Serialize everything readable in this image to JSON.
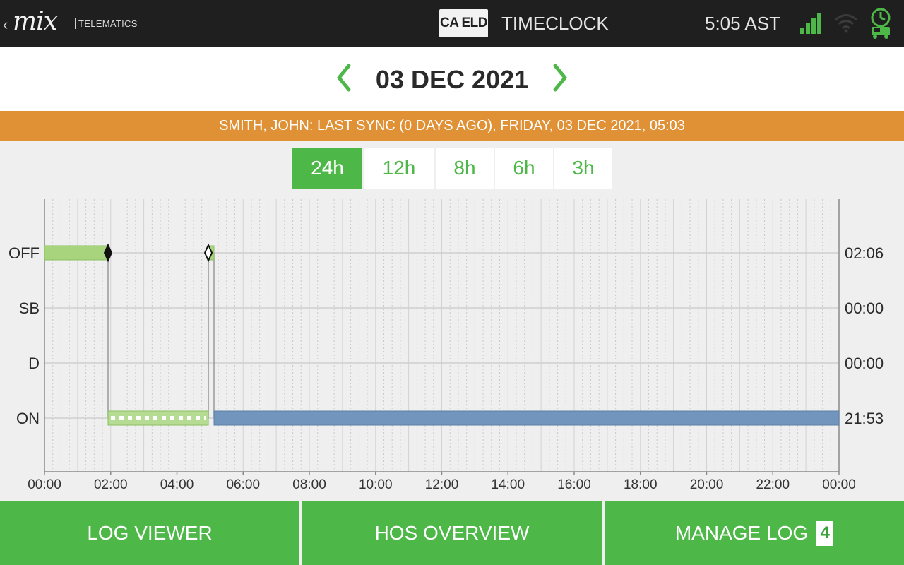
{
  "header": {
    "logo_text": "mix",
    "logo_sub": "TELEMATICS",
    "badge": "CA ELD",
    "title": "TIMECLOCK",
    "time": "5:05 AST",
    "icons": [
      "back-chevron-icon",
      "signal-bars-icon",
      "wifi-icon",
      "truck-clock-icon"
    ],
    "accent_color": "#4db748"
  },
  "date_nav": {
    "date": "03 DEC 2021",
    "prev_icon": "chevron-left-icon",
    "next_icon": "chevron-right-icon"
  },
  "sync_banner": {
    "text": "SMITH, JOHN: LAST SYNC (0 DAYS AGO), FRIDAY, 03 DEC 2021, 05:03",
    "color": "#e09035"
  },
  "range_tabs": [
    {
      "label": "24h",
      "active": true
    },
    {
      "label": "12h",
      "active": false
    },
    {
      "label": "8h",
      "active": false
    },
    {
      "label": "6h",
      "active": false
    },
    {
      "label": "3h",
      "active": false
    }
  ],
  "chart_data": {
    "type": "duty-status-log",
    "statuses": [
      "OFF",
      "SB",
      "D",
      "ON"
    ],
    "status_totals": [
      "02:06",
      "00:00",
      "00:00",
      "21:53"
    ],
    "x_ticks": [
      "00:00",
      "02:00",
      "04:00",
      "06:00",
      "08:00",
      "10:00",
      "12:00",
      "14:00",
      "16:00",
      "18:00",
      "20:00",
      "22:00",
      "00:00"
    ],
    "x_range_hours": [
      0,
      24
    ],
    "segments": [
      {
        "status": "OFF",
        "start": 0.0,
        "end": 1.92,
        "style": "certified"
      },
      {
        "status": "ON",
        "start": 1.92,
        "end": 4.95,
        "style": "edited"
      },
      {
        "status": "OFF",
        "start": 4.95,
        "end": 5.12,
        "style": "certified"
      },
      {
        "status": "ON",
        "start": 5.12,
        "end": 24.0,
        "style": "current"
      }
    ],
    "markers": [
      {
        "status": "OFF",
        "time": 1.92,
        "type": "filled-diamond"
      },
      {
        "status": "OFF",
        "time": 4.95,
        "type": "hollow-diamond"
      }
    ],
    "colors": {
      "certified": "#a8d47e",
      "edited": "#b5dc92",
      "current": "#7295bd"
    },
    "grid": true
  },
  "bottom_buttons": [
    {
      "label": "LOG VIEWER"
    },
    {
      "label": "HOS OVERVIEW"
    },
    {
      "label": "MANAGE LOG",
      "count": "4"
    }
  ]
}
